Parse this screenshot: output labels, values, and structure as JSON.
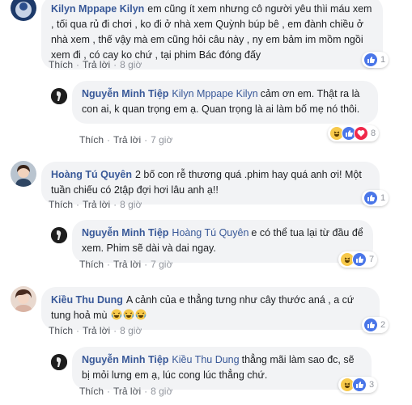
{
  "actions": {
    "like": "Thích",
    "reply": "Trả lời",
    "sep": "·"
  },
  "comments": [
    {
      "name": "Kilyn Mppape Kilyn",
      "text": "em cũng ít xem nhưng cô người yêu thìi máu xem , tối qua rủ đi chơi , ko đi ở nhà xem Quỳnh búp bê , em đành chiều ở nhà xem , thế vậy mà em cũng hỏi câu này , ny em bảm im mồm ngồi xem đi , có cay ko chứ , tại phim Bác đóng đấy",
      "time": "8 giờ",
      "reaction_count": "1"
    },
    {
      "name": "Nguyễn Minh Tiệp",
      "mention": "Kilyn Mppape Kilyn",
      "text": "cảm ơn em. Thật ra là con ai, k quan trọng em ạ. Quan trọng là ai làm bố mẹ nó thôi.",
      "time": "7 giờ",
      "reaction_count": "8"
    },
    {
      "name": "Hoàng Tú Quyên",
      "text": "2 bố con rễ thương quá .phim hay quá anh ơi! Một tuần chiếu có 2tập đợi hơi lâu anh ạ!!",
      "time": "8 giờ",
      "reaction_count": "1"
    },
    {
      "name": "Nguyễn Minh Tiệp",
      "mention": "Hoàng Tú Quyên",
      "text": "e có thể tua lại từ đầu để xem. Phim sẽ dài và dai ngay.",
      "time": "7 giờ",
      "reaction_count": "7"
    },
    {
      "name": "Kiều Thu Dung",
      "text": "A cảnh của e thẳng tưng như cây thước aná , a cứ tung hoả mù",
      "time": "8 giờ",
      "reaction_count": "2"
    },
    {
      "name": "Nguyễn Minh Tiệp",
      "mention": "Kiều Thu Dung",
      "text": "thẳng mãi làm sao đc, sẽ bị mỏi lưng em ạ, lúc cong lúc thẳng chứ.",
      "time": "8 giờ",
      "reaction_count": "3"
    }
  ],
  "colors": {
    "name": "#385898",
    "bubble": "#f2f3f5",
    "like": "#4a76e8",
    "heart": "#f0284a",
    "haha": "#f7c94b"
  }
}
